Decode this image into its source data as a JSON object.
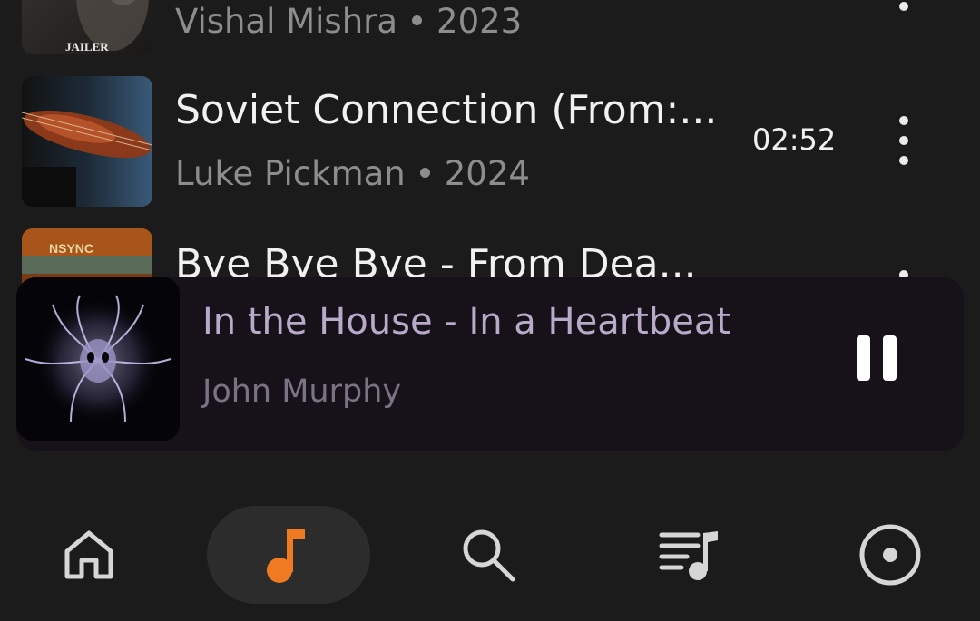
{
  "tracks": [
    {
      "title": "",
      "artist": "Vishal Mishra",
      "year": "2023",
      "art_text": "JAILER",
      "duration": ""
    },
    {
      "title": "Soviet Connection (From:...",
      "artist": "Luke Pickman",
      "year": "2024",
      "duration": "02:52"
    },
    {
      "title": "Bye Bye Bye - From Dea...",
      "artist": "",
      "year": "",
      "duration": ""
    }
  ],
  "now_playing": {
    "title": "In the House - In a Heartbeat",
    "artist": "John Murphy",
    "state": "playing"
  },
  "nav": {
    "items": [
      {
        "name": "home",
        "icon": "home-icon"
      },
      {
        "name": "songs",
        "icon": "music-note-icon",
        "active": true
      },
      {
        "name": "search",
        "icon": "search-icon"
      },
      {
        "name": "playlists",
        "icon": "playlist-icon"
      },
      {
        "name": "albums",
        "icon": "disc-icon"
      }
    ]
  },
  "colors": {
    "background": "#1b1b1b",
    "accent": "#f07a22",
    "mini_player_bg": "#17121a"
  }
}
